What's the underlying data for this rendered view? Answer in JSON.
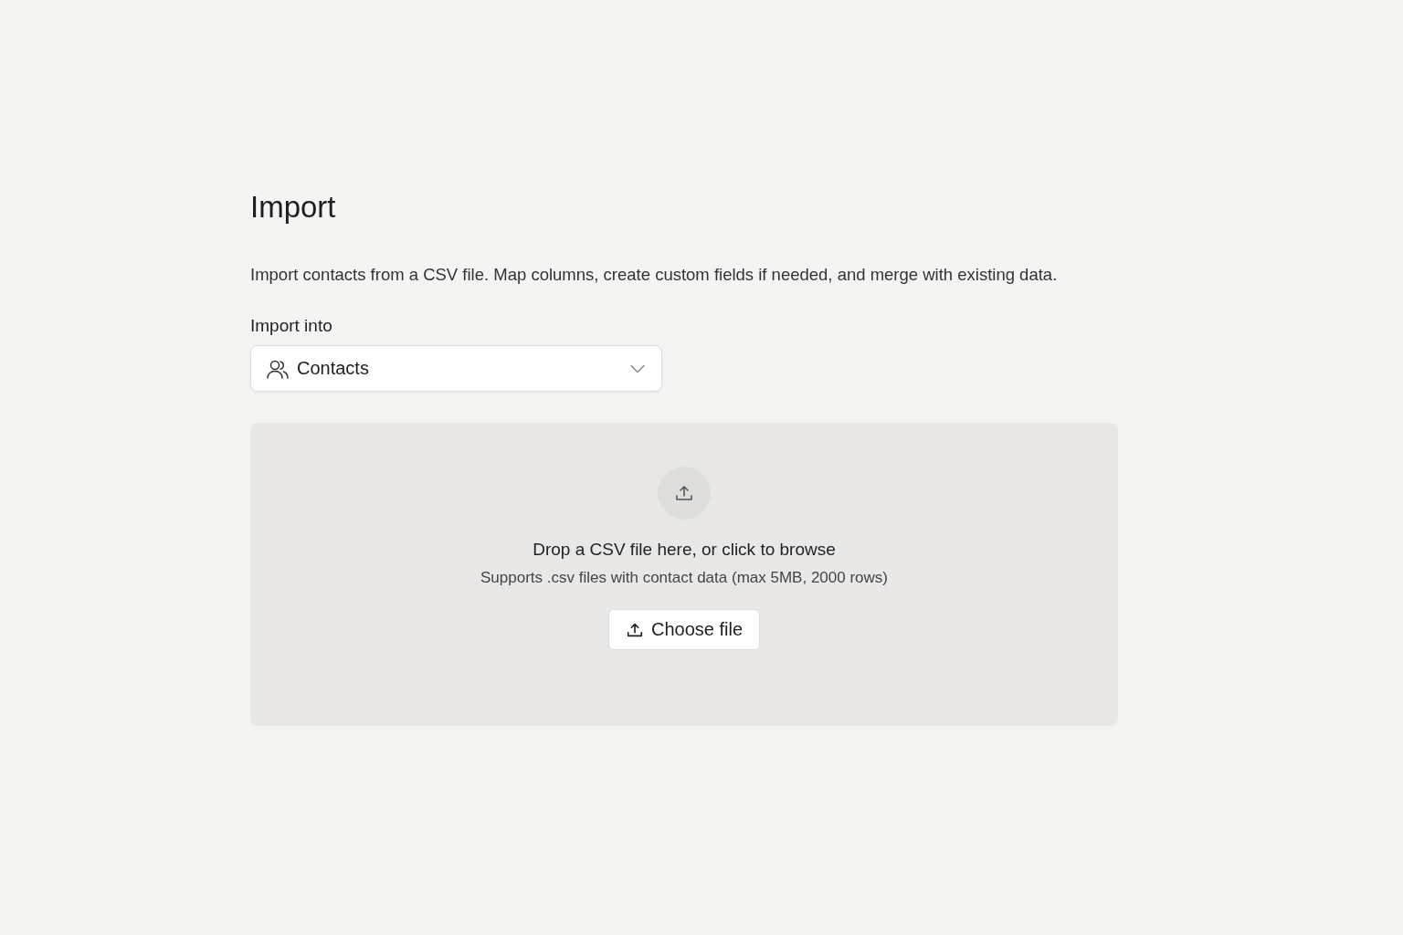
{
  "page": {
    "title": "Import",
    "description": "Import contacts from a CSV file. Map columns, create custom fields if needed, and merge with existing data."
  },
  "import_into": {
    "label": "Import into",
    "value": "Contacts"
  },
  "dropzone": {
    "title": "Drop a CSV file here, or click to browse",
    "hint": "Supports .csv files with contact data (max 5MB, 2000 rows)",
    "button": "Choose file"
  }
}
